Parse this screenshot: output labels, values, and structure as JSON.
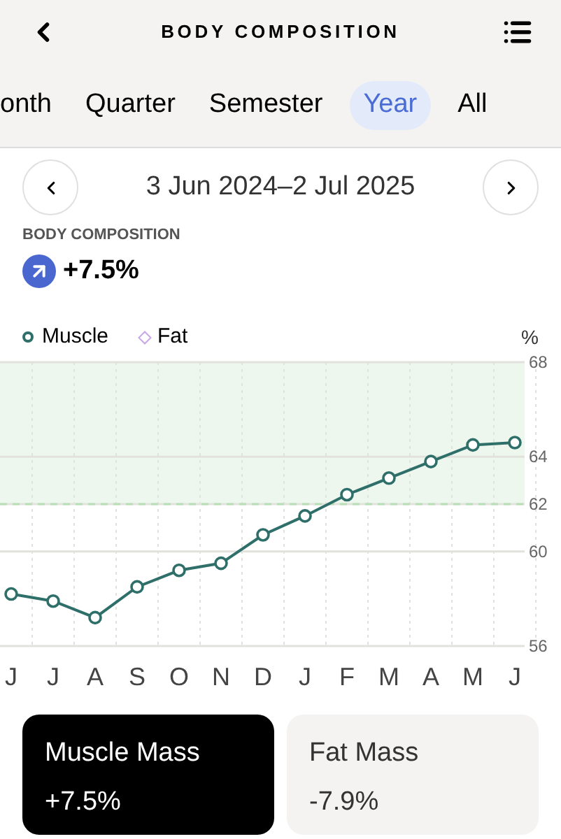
{
  "header": {
    "title": "BODY COMPOSITION"
  },
  "tabs": [
    {
      "label": "onth",
      "selected": false
    },
    {
      "label": "Quarter",
      "selected": false
    },
    {
      "label": "Semester",
      "selected": false
    },
    {
      "label": "Year",
      "selected": true
    },
    {
      "label": "All",
      "selected": false
    }
  ],
  "date_range": "3 Jun 2024–2 Jul 2025",
  "summary": {
    "label": "BODY COMPOSITION",
    "change": "+7.5%"
  },
  "chart": {
    "unit": "%",
    "chart_data": {
      "type": "line",
      "categories": [
        "J",
        "J",
        "A",
        "S",
        "O",
        "N",
        "D",
        "J",
        "F",
        "M",
        "A",
        "M",
        "J"
      ],
      "ylim": [
        56,
        68
      ],
      "yticks": [
        56,
        60,
        62,
        64,
        68
      ],
      "grid": true,
      "bands": [
        {
          "axis": "y",
          "from": 62,
          "to": 68,
          "color": "#eef7ee"
        }
      ],
      "ref_lines": [
        {
          "axis": "y",
          "value": 62,
          "color": "#b7e0b5"
        }
      ],
      "series": [
        {
          "name": "Muscle",
          "color": "#2f6f6a",
          "marker": "circle",
          "values": [
            58.2,
            57.9,
            57.2,
            58.5,
            59.2,
            59.5,
            60.7,
            61.5,
            62.4,
            63.1,
            63.8,
            64.5,
            64.6
          ]
        },
        {
          "name": "Fat",
          "color": "#c9a6e6",
          "marker": "diamond",
          "values": [
            null,
            null,
            null,
            null,
            null,
            null,
            null,
            null,
            null,
            null,
            null,
            null,
            null
          ]
        }
      ]
    }
  },
  "cards": [
    {
      "title": "Muscle Mass",
      "value": "+7.5%",
      "selected": true
    },
    {
      "title": "Fat Mass",
      "value": "-7.9%",
      "selected": false
    }
  ]
}
